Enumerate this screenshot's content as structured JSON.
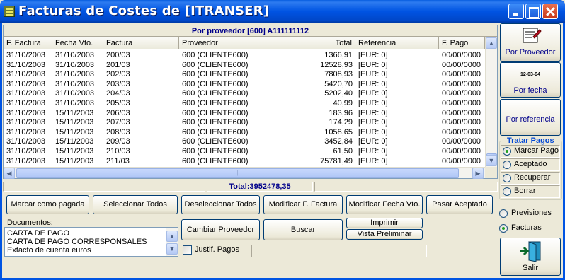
{
  "window": {
    "title": "Facturas de Costes de [ITRANSER]"
  },
  "grid": {
    "header_title": "Por proveedor [600] A111111112",
    "columns": [
      "F. Factura",
      "Fecha Vto.",
      "Factura",
      "Proveedor",
      "Total",
      "Referencia",
      "F. Pago"
    ],
    "rows": [
      [
        "31/10/2003",
        "31/10/2003",
        "200/03",
        "600 (CLIENTE600)",
        "1366,91",
        "[EUR: 0]",
        "00/00/0000"
      ],
      [
        "31/10/2003",
        "31/10/2003",
        "201/03",
        "600 (CLIENTE600)",
        "12528,93",
        "[EUR: 0]",
        "00/00/0000"
      ],
      [
        "31/10/2003",
        "31/10/2003",
        "202/03",
        "600 (CLIENTE600)",
        "7808,93",
        "[EUR: 0]",
        "00/00/0000"
      ],
      [
        "31/10/2003",
        "31/10/2003",
        "203/03",
        "600 (CLIENTE600)",
        "5420,70",
        "[EUR: 0]",
        "00/00/0000"
      ],
      [
        "31/10/2003",
        "31/10/2003",
        "204/03",
        "600 (CLIENTE600)",
        "5202,40",
        "[EUR: 0]",
        "00/00/0000"
      ],
      [
        "31/10/2003",
        "31/10/2003",
        "205/03",
        "600 (CLIENTE600)",
        "40,99",
        "[EUR: 0]",
        "00/00/0000"
      ],
      [
        "31/10/2003",
        "15/11/2003",
        "206/03",
        "600 (CLIENTE600)",
        "183,96",
        "[EUR: 0]",
        "00/00/0000"
      ],
      [
        "31/10/2003",
        "15/11/2003",
        "207/03",
        "600 (CLIENTE600)",
        "174,29",
        "[EUR: 0]",
        "00/00/0000"
      ],
      [
        "31/10/2003",
        "15/11/2003",
        "208/03",
        "600 (CLIENTE600)",
        "1058,65",
        "[EUR: 0]",
        "00/00/0000"
      ],
      [
        "31/10/2003",
        "15/11/2003",
        "209/03",
        "600 (CLIENTE600)",
        "3452,84",
        "[EUR: 0]",
        "00/00/0000"
      ],
      [
        "31/10/2003",
        "15/11/2003",
        "210/03",
        "600 (CLIENTE600)",
        "61,50",
        "[EUR: 0]",
        "00/00/0000"
      ],
      [
        "31/10/2003",
        "15/11/2003",
        "211/03",
        "600 (CLIENTE600)",
        "75781,49",
        "[EUR: 0]",
        "00/00/0000"
      ]
    ],
    "hscroll_grip": "|||"
  },
  "total": {
    "label": "Total:3952478,35"
  },
  "buttons": {
    "marcar_pagada": "Marcar como pagada",
    "seleccionar_todos": "Seleccionar Todos",
    "deseleccionar_todos": "Deseleccionar Todos",
    "modificar_factura": "Modificar F. Factura",
    "modificar_fecha_vto": "Modificar Fecha Vto.",
    "pasar_aceptado": "Pasar Aceptado",
    "cambiar_proveedor": "Cambiar Proveedor",
    "buscar": "Buscar",
    "imprimir": "Imprimir",
    "vista_preliminar": "Vista Preliminar"
  },
  "documents": {
    "label": "Documentos:",
    "items": [
      "CARTA DE PAGO",
      "CARTA DE PAGO CORRESPONSALES",
      "Extacto de cuenta euros"
    ]
  },
  "justif": {
    "label": "Justif. Pagos",
    "checked": false
  },
  "side": {
    "por_proveedor": "Por Proveedor",
    "por_fecha": "Por fecha",
    "por_fecha_icon_text": "12-03-94",
    "por_referencia": "Por referencia",
    "salir": "Salir"
  },
  "tratar_pagos": {
    "title": "Tratar Pagos",
    "options": [
      "Marcar Pago",
      "Aceptado",
      "Recuperar",
      "Borrar"
    ],
    "selected": "Marcar Pago"
  },
  "view_mode": {
    "options": [
      "Previsiones",
      "Facturas"
    ],
    "selected": "Facturas"
  },
  "colors": {
    "title_bar": "#0054e3",
    "header_text": "#00008b",
    "side_caption": "#00008b",
    "group_title": "#0046d5"
  }
}
